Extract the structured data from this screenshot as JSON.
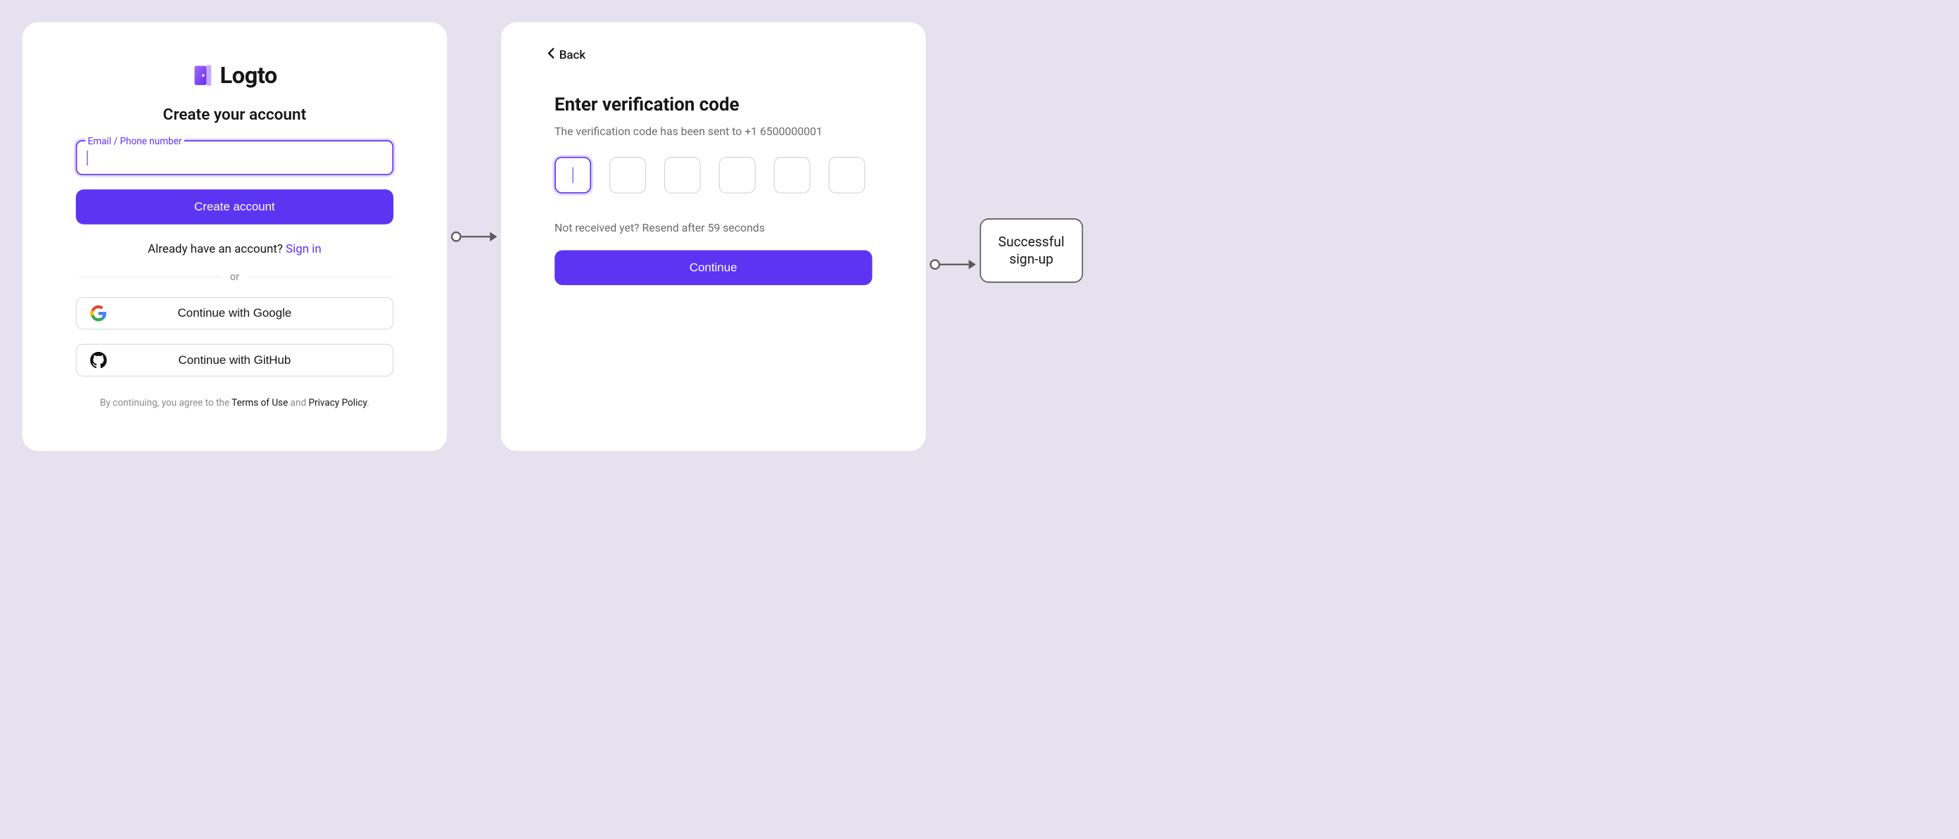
{
  "colors": {
    "accent": "#5d34f2"
  },
  "signup": {
    "brand": "Logto",
    "title": "Create your account",
    "field_label": "Email / Phone number",
    "field_value": "",
    "create_button": "Create account",
    "already_prefix": "Already have an account?",
    "signin_link": "Sign in",
    "divider": "or",
    "google_button": "Continue with Google",
    "github_button": "Continue with GitHub",
    "disclaimer_prefix": "By continuing, you agree to the ",
    "terms": "Terms of Use",
    "disclaimer_and": " and ",
    "privacy": "Privacy Policy",
    "disclaimer_suffix": "."
  },
  "verify": {
    "back_label": "Back",
    "title": "Enter verification code",
    "sent_to_prefix": "The verification code has been sent to ",
    "sent_to_number": "+1 6500000001",
    "resend_prefix": "Not received yet? Resend after ",
    "resend_seconds": "59",
    "resend_suffix": " seconds",
    "continue_button": "Continue"
  },
  "success": {
    "line1": "Successful",
    "line2": "sign-up"
  }
}
